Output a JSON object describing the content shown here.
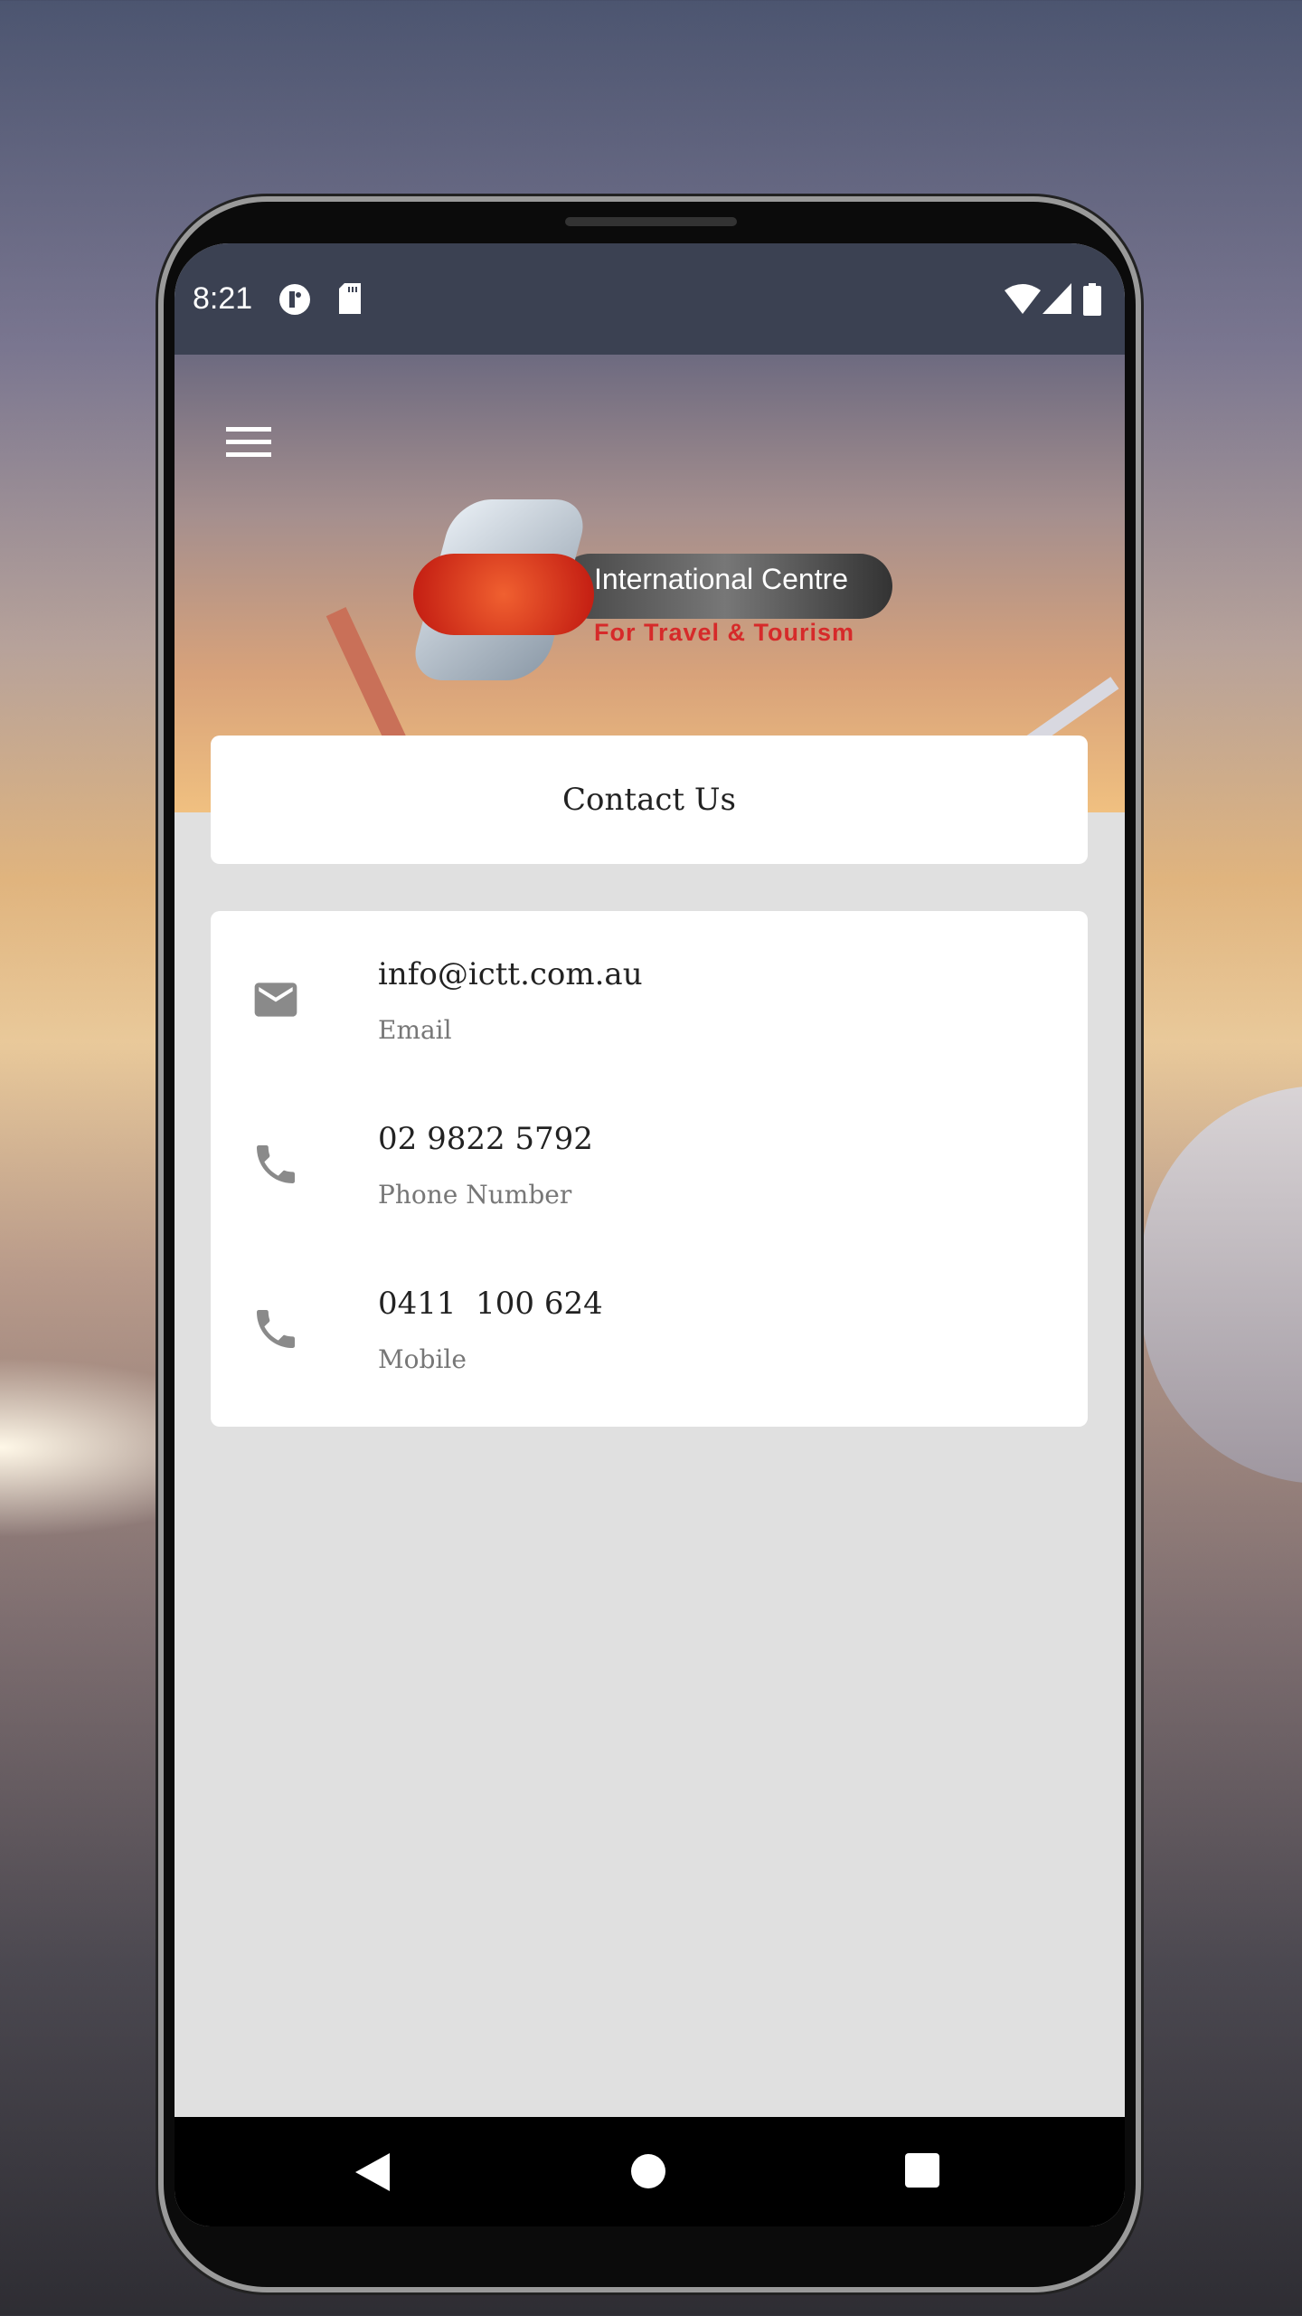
{
  "status_bar": {
    "time": "8:21",
    "icons": [
      "notification-app-icon",
      "sd-card-icon",
      "wifi-icon",
      "signal-icon",
      "battery-icon"
    ]
  },
  "header": {
    "menu_icon": "hamburger-icon",
    "logo": {
      "line1": "International Centre",
      "line2": "For Travel & Tourism"
    }
  },
  "page_title": "Contact Us",
  "contacts": [
    {
      "icon": "email-icon",
      "value": "info@ictt.com.au",
      "label": "Email"
    },
    {
      "icon": "phone-icon",
      "value": "02 9822 5792",
      "label": "Phone Number"
    },
    {
      "icon": "phone-icon",
      "value": "0411  100 624",
      "label": "Mobile"
    }
  ],
  "nav_bar": {
    "buttons": [
      "back",
      "home",
      "recents"
    ]
  },
  "colors": {
    "icon_gray": "#8a8a8a",
    "background": "#e0e0e0",
    "logo_red": "#d62a2a"
  }
}
